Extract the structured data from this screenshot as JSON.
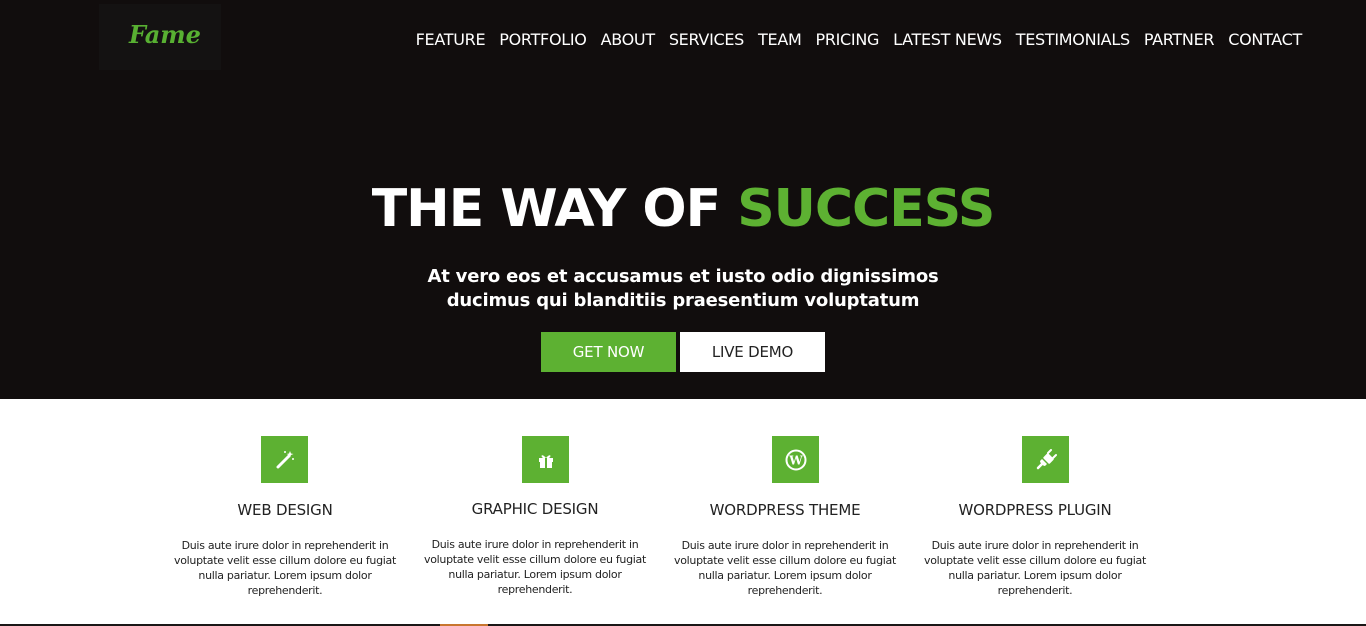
{
  "brand": {
    "logo_text": "Fame"
  },
  "nav": {
    "items": [
      {
        "label": "FEATURE"
      },
      {
        "label": "PORTFOLIO"
      },
      {
        "label": "ABOUT"
      },
      {
        "label": "SERVICES"
      },
      {
        "label": "TEAM"
      },
      {
        "label": "PRICING"
      },
      {
        "label": "LATEST NEWS"
      },
      {
        "label": "TESTIMONIALS"
      },
      {
        "label": "PARTNER"
      },
      {
        "label": "CONTACT"
      }
    ]
  },
  "hero": {
    "headline_part1": "THE WAY OF",
    "headline_accent": "SUCCESS",
    "subtitle_line1": "At vero eos et accusamus et iusto odio dignissimos",
    "subtitle_line2": "ducimus qui blanditiis praesentium voluptatum",
    "buttons": {
      "primary": "GET NOW",
      "secondary": "LIVE DEMO"
    }
  },
  "features": [
    {
      "icon": "magic-wand-icon",
      "title": "WEB DESIGN",
      "description": "Duis aute irure dolor in reprehenderit in voluptate velit esse cillum dolore eu fugiat nulla pariatur. Lorem ipsum dolor reprehenderit."
    },
    {
      "icon": "gift-icon",
      "title": "GRAPHIC DESIGN",
      "description": "Duis aute irure dolor in reprehenderit in voluptate velit esse cillum dolore eu fugiat nulla pariatur. Lorem ipsum dolor reprehenderit."
    },
    {
      "icon": "wordpress-icon",
      "title": "WORDPRESS THEME",
      "description": "Duis aute irure dolor in reprehenderit in voluptate velit esse cillum dolore eu fugiat nulla pariatur. Lorem ipsum dolor reprehenderit."
    },
    {
      "icon": "plug-icon",
      "title": "WORDPRESS PLUGIN",
      "description": "Duis aute irure dolor in reprehenderit in voluptate velit esse cillum dolore eu fugiat nulla pariatur. Lorem ipsum dolor reprehenderit."
    }
  ],
  "colors": {
    "accent": "#5db132",
    "hero_background": "#110d0d",
    "text": "#222222"
  }
}
